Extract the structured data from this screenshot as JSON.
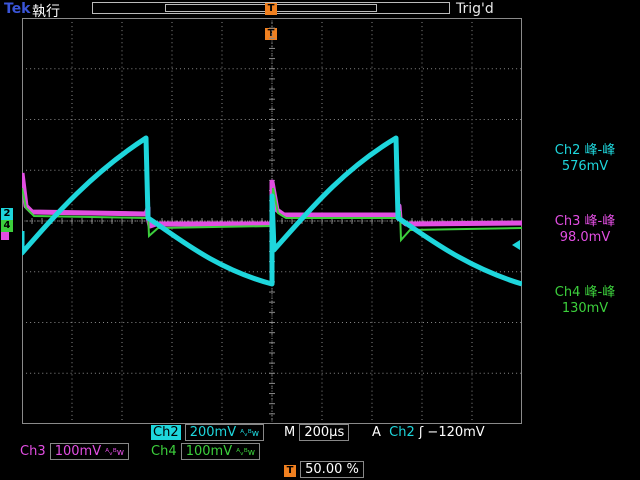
{
  "header": {
    "brand": "Tek",
    "status": "執行",
    "trigger_state": "Trig'd",
    "trigger_marker": "T"
  },
  "readouts": {
    "ch2": {
      "label": "Ch2 峰-峰",
      "value": "576mV"
    },
    "ch3": {
      "label": "Ch3 峰-峰",
      "value": "98.0mV"
    },
    "ch4": {
      "label": "Ch4 峰-峰",
      "value": "130mV"
    }
  },
  "channel_markers": {
    "ch2": "2",
    "ch4": "4"
  },
  "bottom": {
    "ch2_label": "Ch2",
    "ch2_scale": "200mV",
    "ch3_label": "Ch3",
    "ch3_scale": "100mV",
    "ch4_label": "Ch4",
    "ch4_scale": "100mV",
    "bw_symbol": "ᴬᵥᴮw",
    "timebase_label": "M",
    "timebase_value": "200μs",
    "trigger_mode": "A",
    "trigger_source": "Ch2",
    "trigger_slope": "ʃ",
    "trigger_level": "−120mV",
    "trigger_pos_marker": "T",
    "trigger_pos_value": "50.00 %"
  },
  "colors": {
    "ch2": "#1ed6dc",
    "ch3": "#e24ee2",
    "ch4": "#3ccf3c",
    "trigger": "#f08020",
    "grid": "#8a8a8a"
  }
}
